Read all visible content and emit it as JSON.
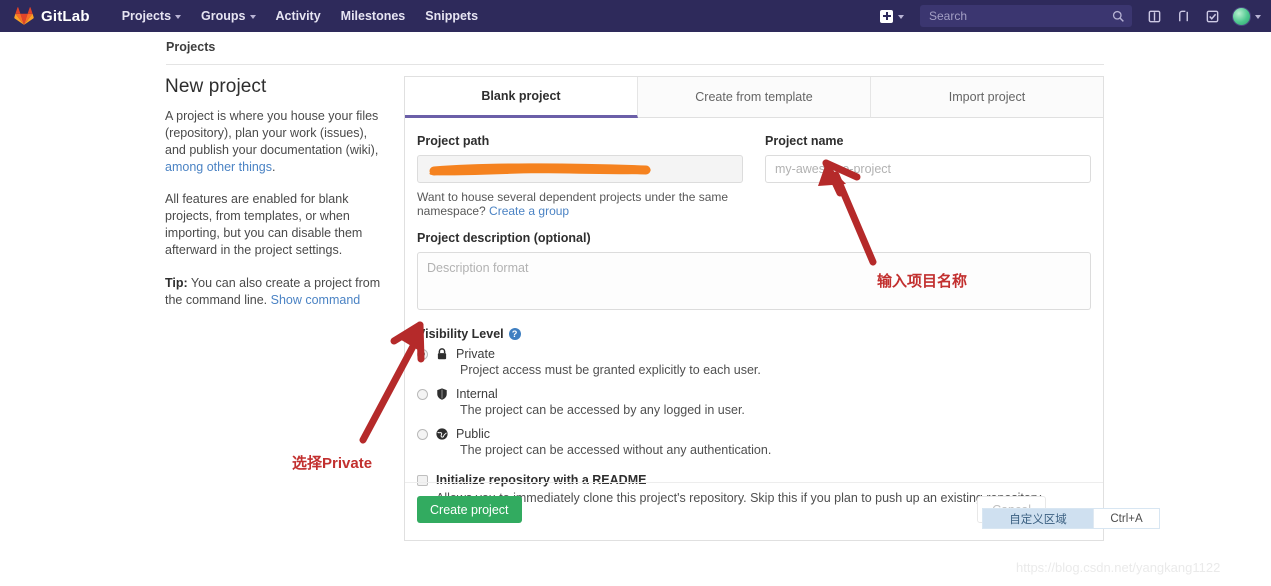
{
  "navbar": {
    "brand": "GitLab",
    "brand_logo_icon": "gitlab-tanuki-icon",
    "links": [
      {
        "label": "Projects",
        "has_caret": true
      },
      {
        "label": "Groups",
        "has_caret": true
      },
      {
        "label": "Activity",
        "has_caret": false
      },
      {
        "label": "Milestones",
        "has_caret": false
      },
      {
        "label": "Snippets",
        "has_caret": false
      }
    ],
    "new_icon": "plus-square-icon",
    "new_caret_icon": "chevron-down-icon",
    "search": {
      "value": "",
      "placeholder": "Search",
      "icon": "search-icon"
    },
    "right_icons": [
      {
        "name": "issues-icon"
      },
      {
        "name": "merge-request-icon"
      },
      {
        "name": "todos-done-icon"
      }
    ],
    "avatar": {
      "name": "user-avatar",
      "caret_icon": "chevron-down-icon"
    },
    "background_color": "#2e2a5b"
  },
  "breadcrumb": {
    "label": "Projects"
  },
  "left": {
    "title": "New project",
    "p1_pre": "A project is where you house your files (repository), plan your work (issues), and publish your documentation (wiki), ",
    "p1_link": "among other things",
    "p1_post": ".",
    "p2": "All features are enabled for blank projects, from templates, or when importing, but you can disable them afterward in the project settings.",
    "p3_label": "Tip:",
    "p3_text": " You can also create a project from the command line. ",
    "p3_link": "Show command"
  },
  "tabs": [
    {
      "label": "Blank project",
      "active": true
    },
    {
      "label": "Create from template",
      "active": false
    },
    {
      "label": "Import project",
      "active": false
    }
  ],
  "form": {
    "project_path": {
      "label": "Project path",
      "value": "",
      "placeholder": "",
      "redacted": true,
      "redaction_color": "#f5821f"
    },
    "project_name": {
      "label": "Project name",
      "value": "",
      "placeholder": "my-awesome-project"
    },
    "namespace_hint_pre": "Want to house several dependent projects under the same namespace? ",
    "namespace_hint_link": "Create a group",
    "description": {
      "label": "Project description (optional)",
      "value": "",
      "placeholder": "Description format"
    },
    "visibility": {
      "label": "Visibility Level",
      "help_icon": "question-circle-icon",
      "options": [
        {
          "name": "Private",
          "icon": "lock-icon",
          "selected": true,
          "description": "Project access must be granted explicitly to each user."
        },
        {
          "name": "Internal",
          "icon": "shield-icon",
          "selected": false,
          "description": "The project can be accessed by any logged in user."
        },
        {
          "name": "Public",
          "icon": "globe-icon",
          "selected": false,
          "description": "The project can be accessed without any authentication."
        }
      ]
    },
    "readme": {
      "label": "Initialize repository with a README",
      "checked": false,
      "description": "Allows you to immediately clone this project's repository. Skip this if you plan to push up an existing repository."
    },
    "submit_label": "Create project",
    "cancel_label": "Cancel"
  },
  "annotations": {
    "color": "#c2302f",
    "project_name_note": "输入项目名称",
    "private_note": "选择Private"
  },
  "screenshot_tool": {
    "region_label": "自定义区域",
    "shortcut": "Ctrl+A"
  },
  "watermark": "https://blog.csdn.net/yangkang1122"
}
